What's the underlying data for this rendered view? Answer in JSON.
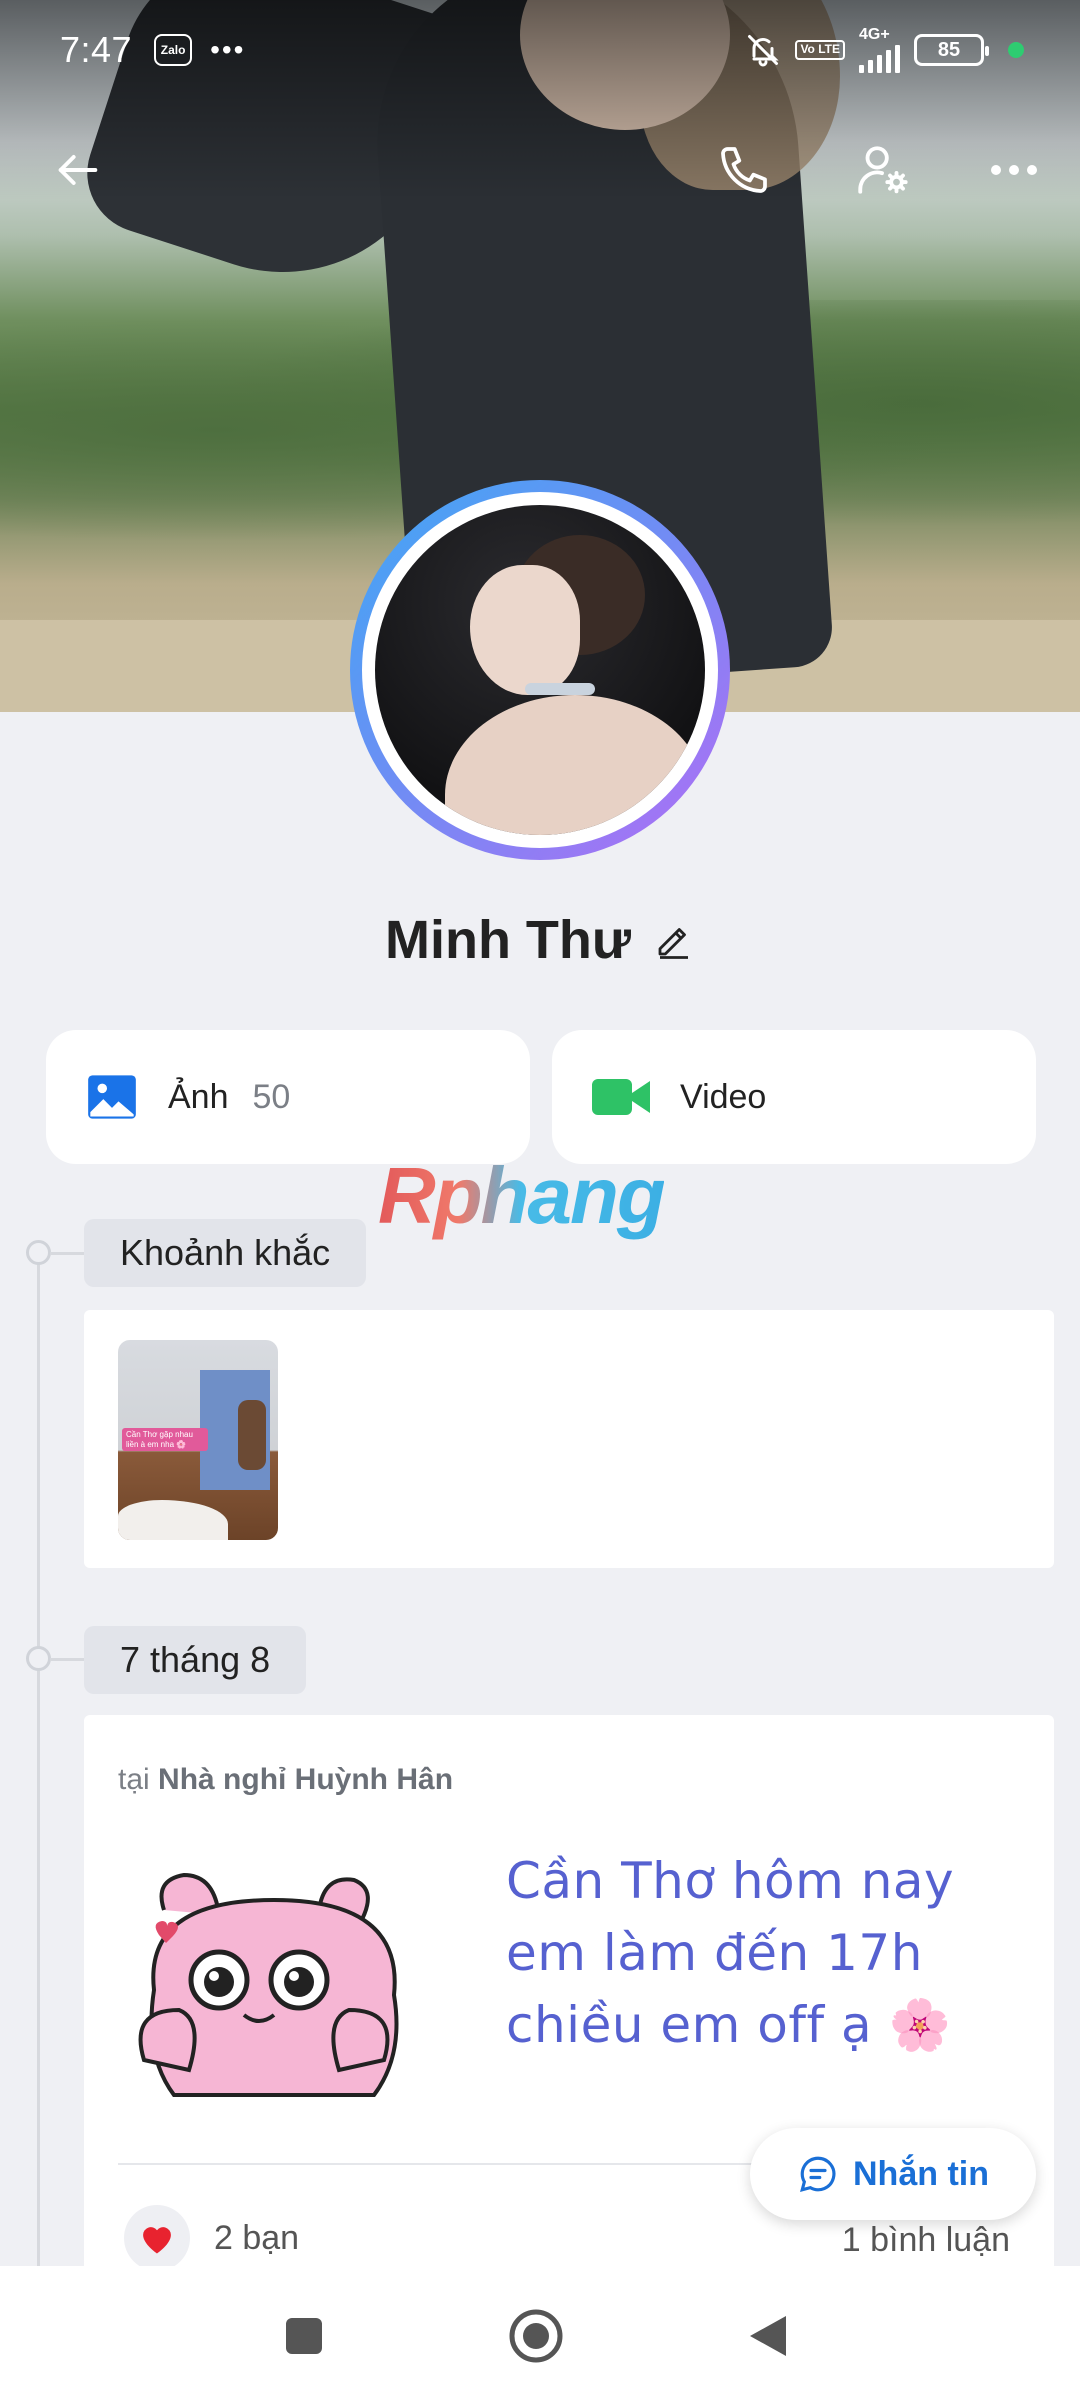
{
  "status_bar": {
    "time": "7:47",
    "app_badge": "Zalo",
    "more": "•••",
    "network": "4G+",
    "volte": "Vo LTE",
    "battery": "85"
  },
  "profile": {
    "name": "Minh Thư"
  },
  "media": {
    "photos_label": "Ảnh",
    "photos_count": "50",
    "video_label": "Video"
  },
  "watermark": "Rphang",
  "timeline": {
    "moments_label": "Khoảnh khắc",
    "moment_thumb_caption": "Cần Thơ gặp nhau liền à em nha 🌸",
    "date_label": "7 tháng 8",
    "post": {
      "location_prefix": "tại",
      "location_name": "Nhà nghỉ Huỳnh Hân",
      "text": "Cần Thơ hôm nay em làm đến 17h chiều em off ạ 🌸",
      "likes_text": "2 bạn",
      "comments_text": "1 bình luận"
    }
  },
  "message_button": {
    "label": "Nhắn tin"
  },
  "colors": {
    "accent_blue": "#1a6fd6",
    "post_text": "#5661d0",
    "ring_start": "#3fa8f5",
    "ring_end": "#b26df5",
    "video_green": "#2ec266",
    "photo_blue": "#1a73e8"
  }
}
